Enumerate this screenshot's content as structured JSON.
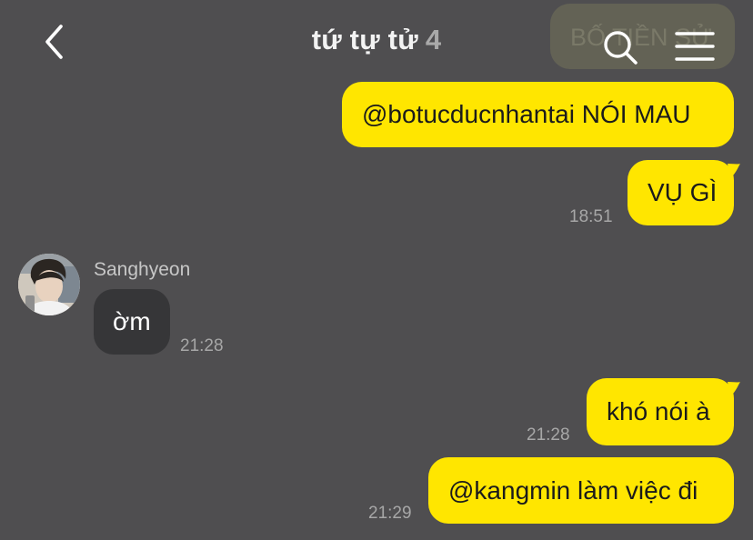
{
  "header": {
    "title": "tứ tự tử",
    "member_count": "4",
    "ghost_preview": "BỐ TIỀN SỬ"
  },
  "icons": {
    "back": "chevron-left-icon",
    "search": "search-icon",
    "menu": "hamburger-menu-icon"
  },
  "colors": {
    "background": "#4f4e50",
    "my_bubble": "#ffe600",
    "their_bubble": "#363638",
    "timestamp": "#a7a7a7"
  },
  "messages": [
    {
      "from": "me",
      "text": "@botucducnhantai NÓI MAU",
      "time": ""
    },
    {
      "from": "me",
      "text": "VỤ GÌ",
      "time": "18:51"
    },
    {
      "from": "Sanghyeon",
      "sender_name": "Sanghyeon",
      "text": "ờm",
      "time": "21:28"
    },
    {
      "from": "me",
      "text": "khó nói à",
      "time": "21:28"
    },
    {
      "from": "me",
      "text": "@kangmin làm việc đi",
      "time": "21:29"
    }
  ]
}
